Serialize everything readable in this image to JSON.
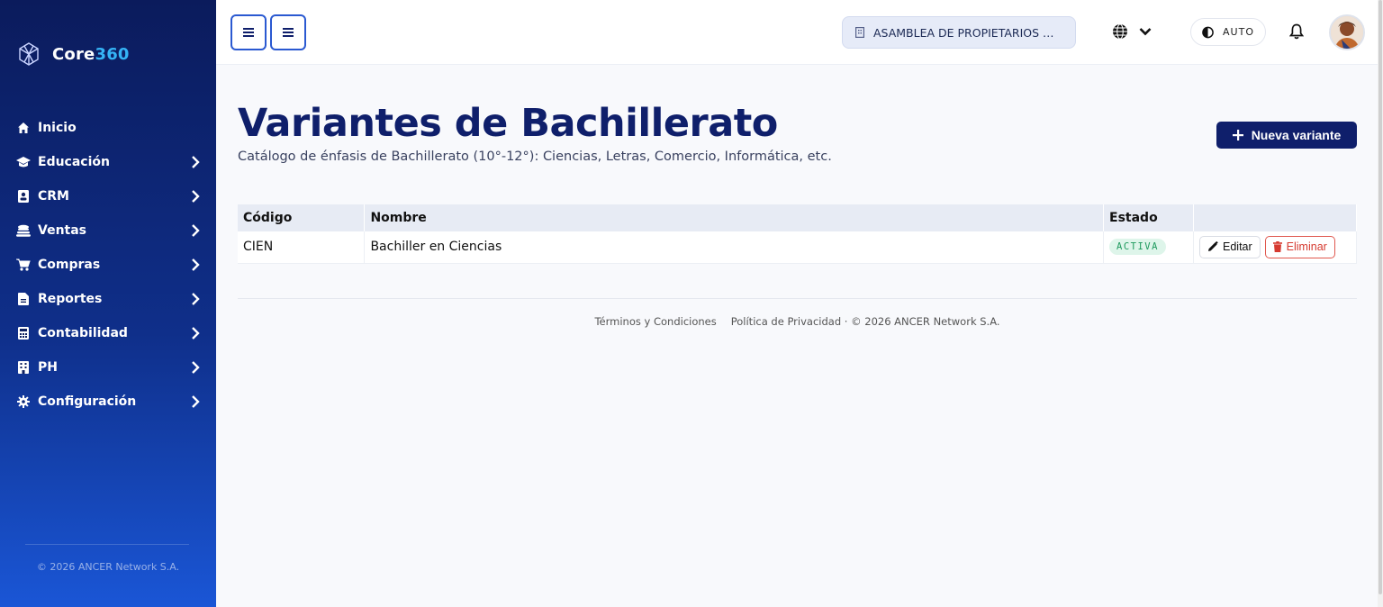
{
  "brand": {
    "name_main": "Core",
    "name_accent": "360"
  },
  "sidebar": {
    "items": [
      {
        "label": "Inicio",
        "icon": "home-icon",
        "expandable": false
      },
      {
        "label": "Educación",
        "icon": "graduation-cap-icon",
        "expandable": true
      },
      {
        "label": "CRM",
        "icon": "contact-card-icon",
        "expandable": true
      },
      {
        "label": "Ventas",
        "icon": "coins-icon",
        "expandable": true
      },
      {
        "label": "Compras",
        "icon": "shopping-cart-icon",
        "expandable": true
      },
      {
        "label": "Reportes",
        "icon": "file-icon",
        "expandable": true
      },
      {
        "label": "Contabilidad",
        "icon": "calculator-icon",
        "expandable": true
      },
      {
        "label": "PH",
        "icon": "building-icon",
        "expandable": true
      },
      {
        "label": "Configuración",
        "icon": "gear-icon",
        "expandable": true
      }
    ],
    "copyright": "© 2026 ANCER Network S.A."
  },
  "topbar": {
    "organization": "ASAMBLEA DE PROPIETARIOS DE …",
    "theme_label": "AUTO"
  },
  "page": {
    "title": "Variantes de Bachillerato",
    "subtitle": "Catálogo de énfasis de Bachillerato (10°-12°): Ciencias, Letras, Comercio, Informática, etc.",
    "new_button": "Nueva variante"
  },
  "table": {
    "columns": [
      "Código",
      "Nombre",
      "Estado",
      ""
    ],
    "rows": [
      {
        "code": "CIEN",
        "name": "Bachiller en Ciencias",
        "status": "ACTIVA"
      }
    ],
    "edit_label": "Editar",
    "delete_label": "Eliminar"
  },
  "footer": {
    "terms": "Términos y Condiciones",
    "privacy": "Política de Privacidad",
    "copyright": "· © 2026 ANCER Network S.A."
  },
  "colors": {
    "primary": "#0f1f6b",
    "accent": "#2a59d1",
    "success": "#1f9a5e",
    "danger": "#d63a30"
  }
}
